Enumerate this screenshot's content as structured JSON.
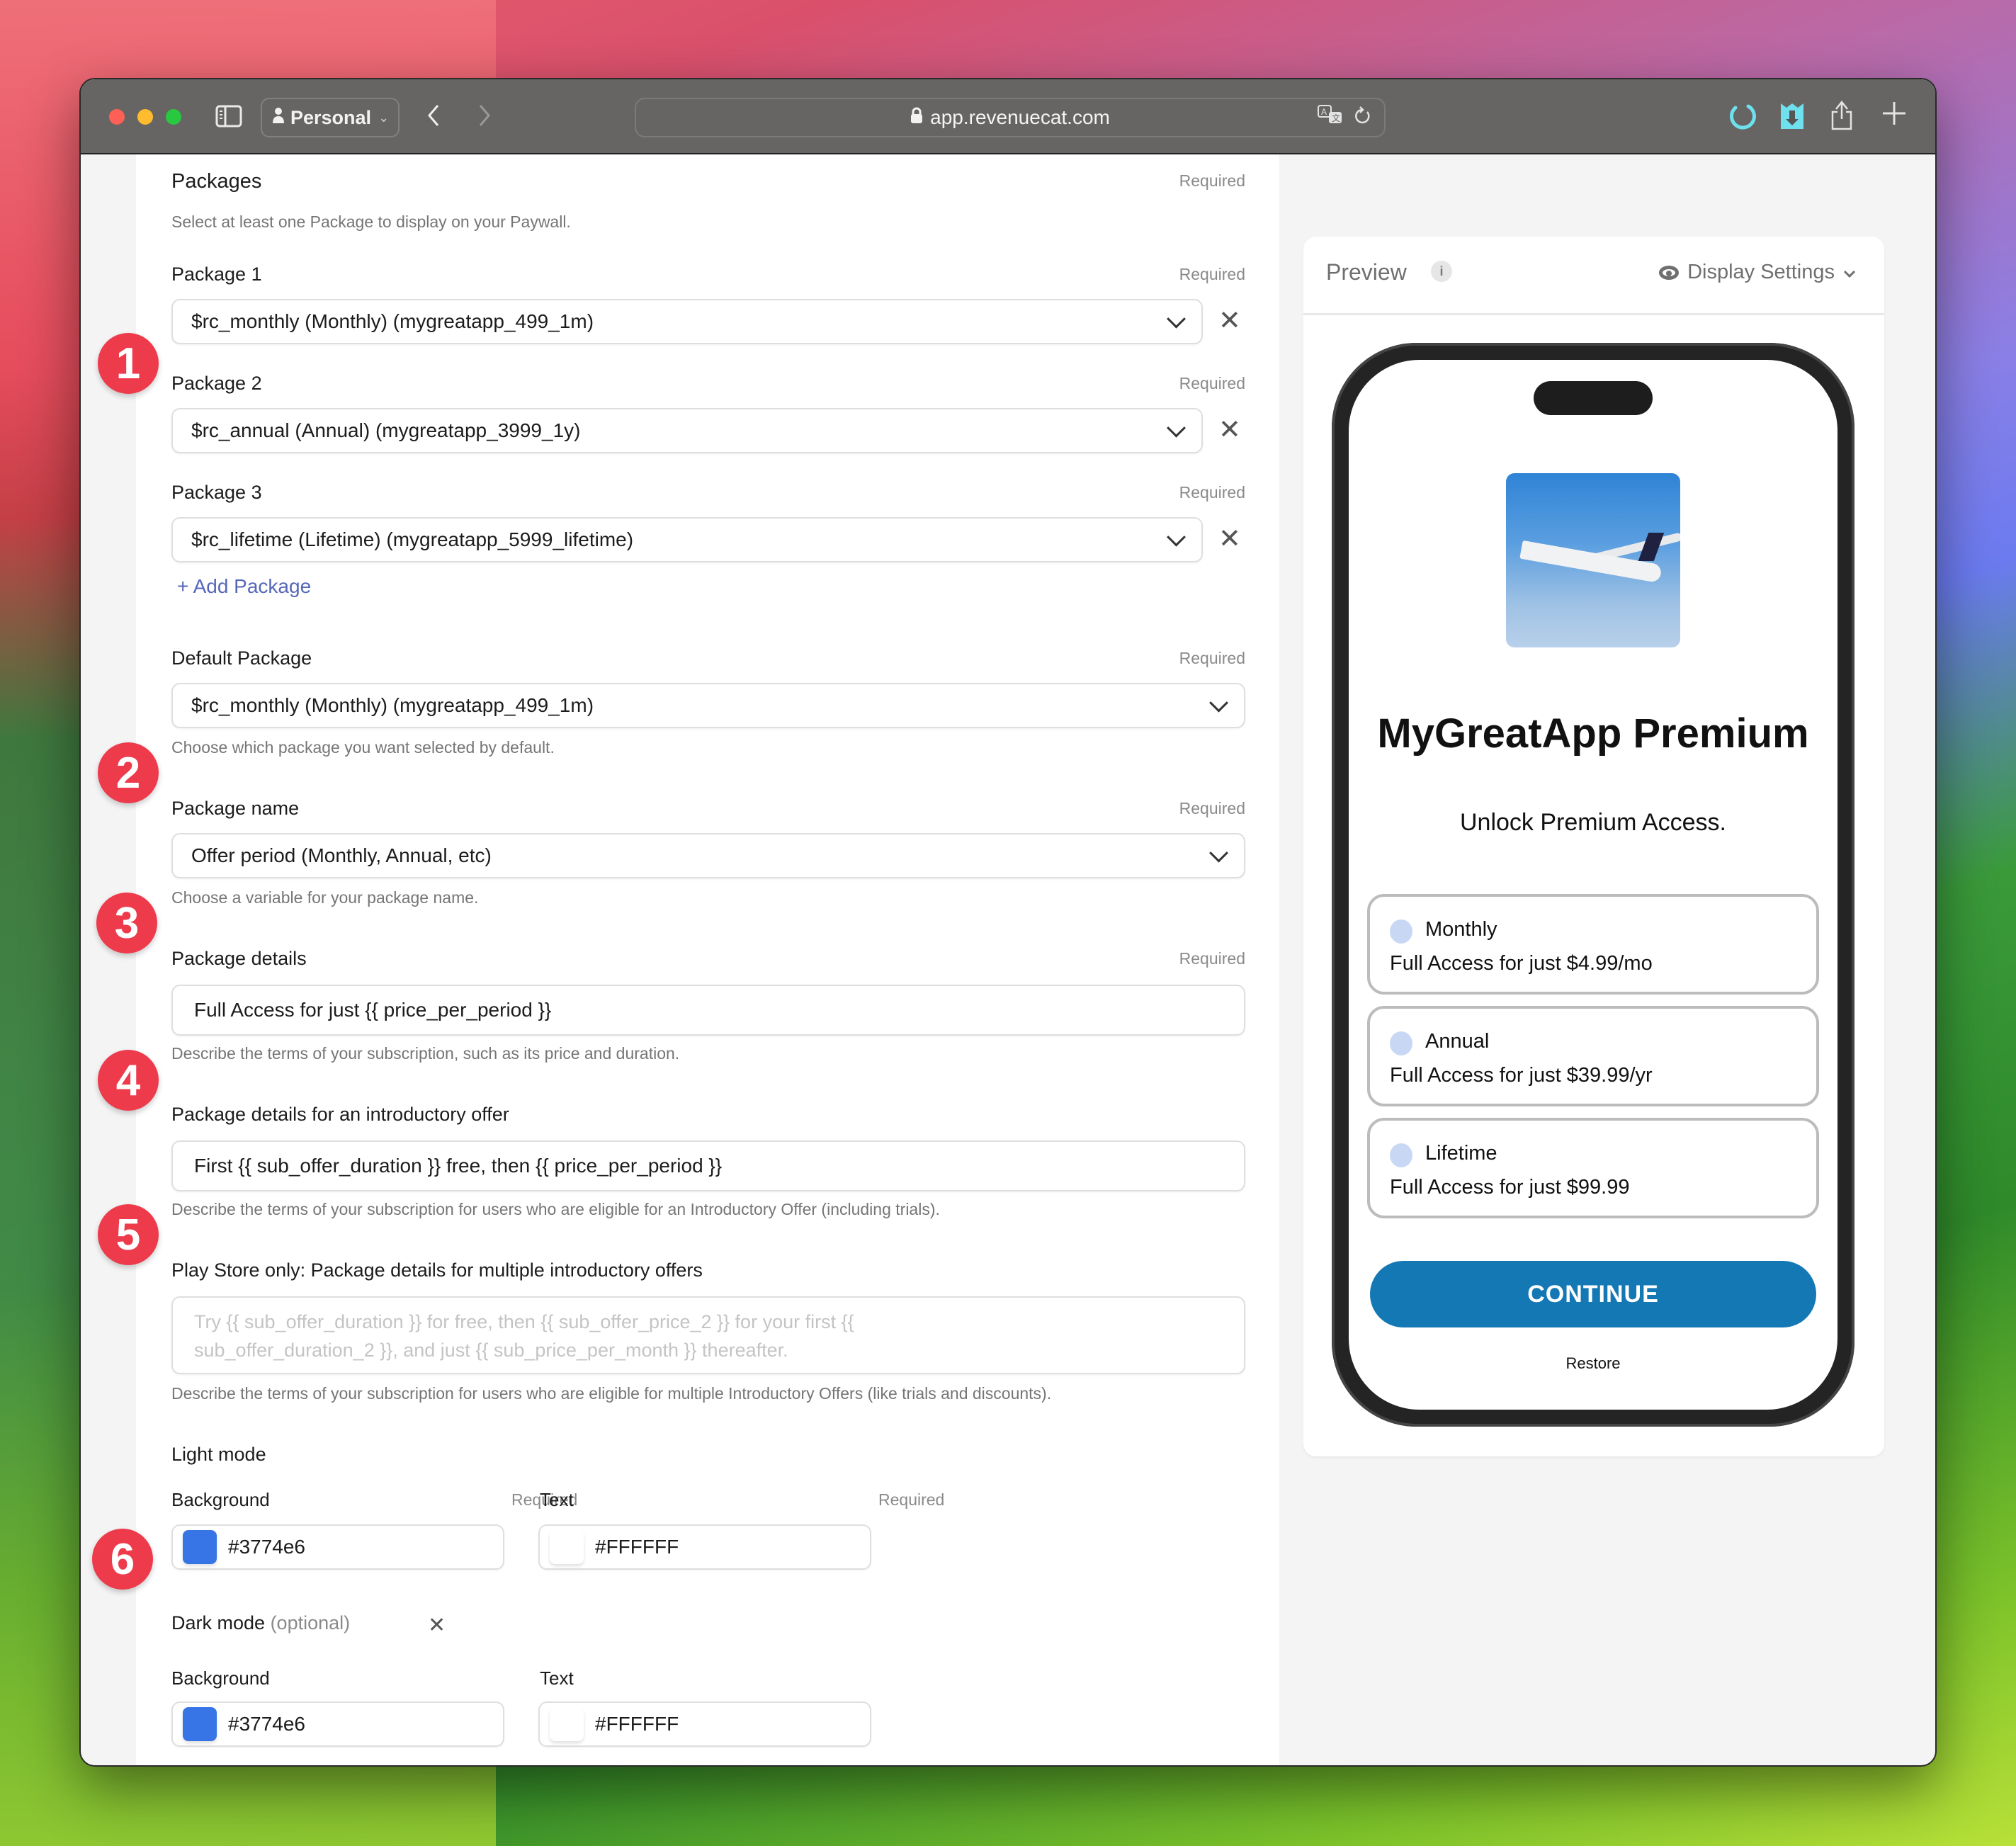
{
  "browser": {
    "profile_label": "Personal",
    "url": "app.revenuecat.com",
    "icons": [
      "sidebar-toggle-icon",
      "back-icon",
      "forward-icon",
      "lock-icon",
      "translate-icon",
      "reload-icon",
      "loading-spinner-icon",
      "extension-icon",
      "share-icon",
      "new-tab-icon"
    ]
  },
  "form": {
    "required_label": "Required",
    "packages": {
      "title": "Packages",
      "help": "Select at least one Package to display on your Paywall.",
      "items": [
        {
          "label": "Package 1",
          "value": "$rc_monthly (Monthly) (mygreatapp_499_1m)"
        },
        {
          "label": "Package 2",
          "value": "$rc_annual (Annual) (mygreatapp_3999_1y)"
        },
        {
          "label": "Package 3",
          "value": "$rc_lifetime (Lifetime) (mygreatapp_5999_lifetime)"
        }
      ],
      "add_label": "+ Add Package"
    },
    "default_package": {
      "label": "Default Package",
      "value": "$rc_monthly (Monthly) (mygreatapp_499_1m)",
      "help": "Choose which package you want selected by default."
    },
    "package_name": {
      "label": "Package name",
      "value": "Offer period (Monthly, Annual, etc)",
      "help": "Choose a variable for your package name."
    },
    "package_details": {
      "label": "Package details",
      "value": "Full Access for just {{ price_per_period }}",
      "help": "Describe the terms of your subscription, such as its price and duration."
    },
    "intro_offer": {
      "label": "Package details for an introductory offer",
      "value": "First {{ sub_offer_duration }} free, then {{ price_per_period }}",
      "help": "Describe the terms of your subscription for users who are eligible for an Introductory Offer (including trials)."
    },
    "multi_intro": {
      "label": "Play Store only: Package details for multiple introductory offers",
      "placeholder_line1": "Try {{ sub_offer_duration }} for free, then {{ sub_offer_price_2 }} for your first {{",
      "placeholder_line2": "sub_offer_duration_2 }}, and just {{ sub_price_per_month }} thereafter.",
      "help": "Describe the terms of your subscription for users who are eligible for multiple Introductory Offers (like trials and discounts)."
    },
    "light_mode": {
      "title": "Light mode",
      "background_label": "Background",
      "background_value": "#3774e6",
      "text_label": "Text",
      "text_value": "#FFFFFF"
    },
    "dark_mode": {
      "title": "Dark mode",
      "optional": "(optional)",
      "background_label": "Background",
      "background_value": "#3774e6",
      "text_label": "Text",
      "text_value": "#FFFFFF"
    }
  },
  "badges": [
    "1",
    "2",
    "3",
    "4",
    "5",
    "6"
  ],
  "preview": {
    "title": "Preview",
    "info": "i",
    "display_settings": "Display Settings",
    "app_title": "MyGreatApp Premium",
    "subtitle": "Unlock Premium Access.",
    "plans": [
      {
        "name": "Monthly",
        "desc": "Full Access for just $4.99/mo"
      },
      {
        "name": "Annual",
        "desc": "Full Access for just $39.99/yr"
      },
      {
        "name": "Lifetime",
        "desc": "Full Access for just $99.99"
      }
    ],
    "continue_label": "CONTINUE",
    "restore_label": "Restore"
  },
  "colors": {
    "badge": "#ee3b4c",
    "continue_button": "#1478b4",
    "swatch_blue": "#3774e6",
    "swatch_white": "#FFFFFF",
    "link": "#5667b8"
  }
}
